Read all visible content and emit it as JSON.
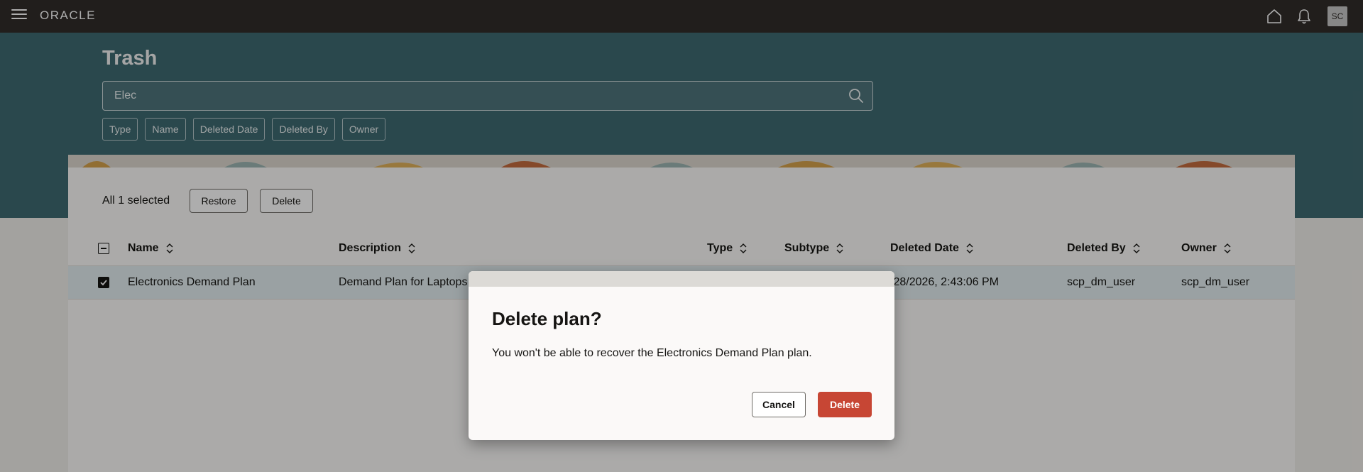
{
  "app": {
    "brand": "ORACLE",
    "avatar_initials": "SC"
  },
  "page": {
    "title": "Trash"
  },
  "search": {
    "value": "Elec"
  },
  "filters": [
    "Type",
    "Name",
    "Deleted Date",
    "Deleted By",
    "Owner"
  ],
  "selection": {
    "label": "All 1 selected",
    "restore_label": "Restore",
    "delete_label": "Delete"
  },
  "table": {
    "columns": [
      "Name",
      "Description",
      "Type",
      "Subtype",
      "Deleted Date",
      "Deleted By",
      "Owner"
    ],
    "rows": [
      {
        "name": "Electronics Demand Plan",
        "description": "Demand Plan for Laptops",
        "deleted_date": "/28/2026, 2:43:06 PM",
        "deleted_by": "scp_dm_user",
        "owner": "scp_dm_user"
      }
    ]
  },
  "dialog": {
    "title": "Delete plan?",
    "message": "You won't be able to recover the Electronics Demand Plan plan.",
    "cancel_label": "Cancel",
    "delete_label": "Delete"
  },
  "colors": {
    "topbar": "#312d2a",
    "banner": "#3f6a72",
    "danger": "#c74634",
    "row_selected": "#e4eef1"
  }
}
